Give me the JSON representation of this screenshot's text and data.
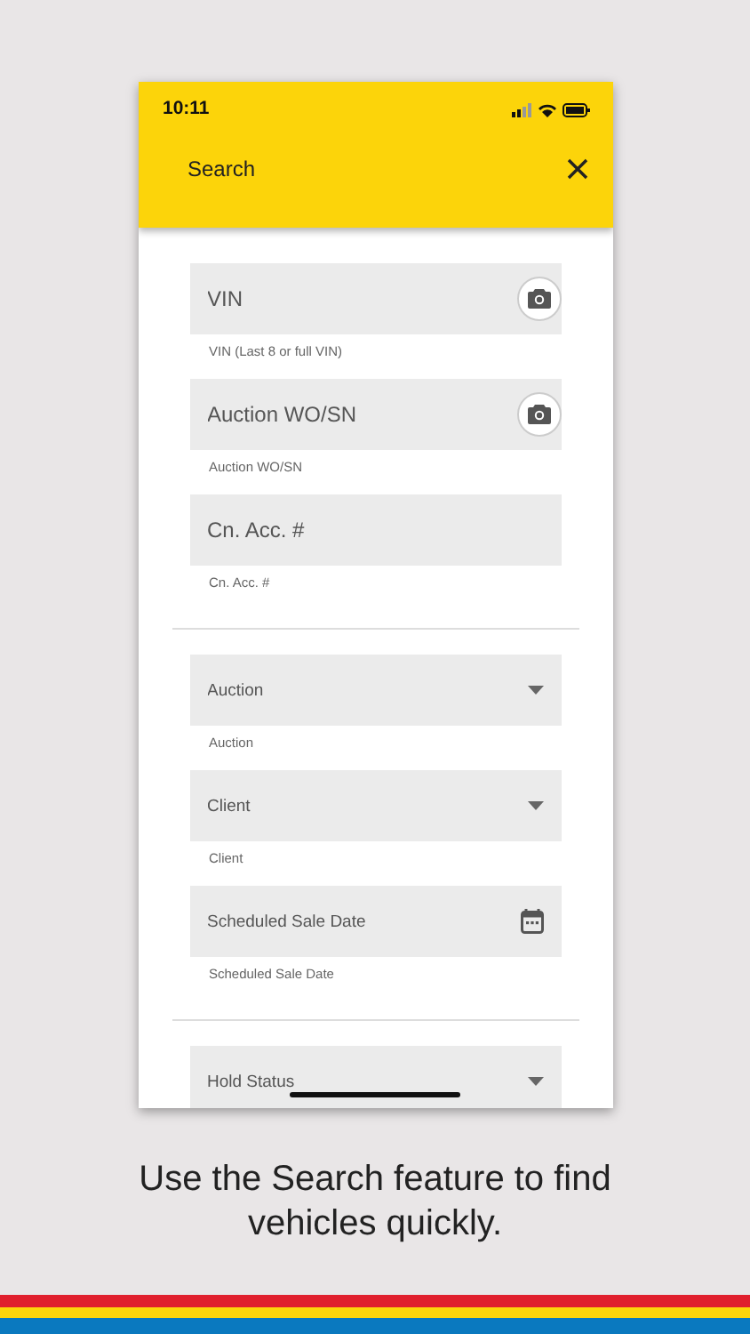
{
  "status_bar": {
    "time": "10:11"
  },
  "header": {
    "title": "Search"
  },
  "sections": [
    {
      "fields": [
        {
          "kind": "camera",
          "placeholder": "VIN",
          "helper": "VIN (Last 8 or full VIN)"
        },
        {
          "kind": "camera",
          "placeholder": "Auction WO/SN",
          "helper": "Auction WO/SN"
        },
        {
          "kind": "text",
          "placeholder": "Cn. Acc. #",
          "helper": "Cn. Acc. #"
        }
      ]
    },
    {
      "fields": [
        {
          "kind": "dropdown",
          "placeholder": "Auction",
          "helper": "Auction"
        },
        {
          "kind": "dropdown",
          "placeholder": "Client",
          "helper": "Client"
        },
        {
          "kind": "date",
          "placeholder": "Scheduled Sale Date",
          "helper": "Scheduled Sale Date"
        }
      ]
    },
    {
      "fields": [
        {
          "kind": "dropdown",
          "placeholder": "Hold Status"
        }
      ]
    }
  ],
  "caption": "Use the Search feature to find vehicles quickly."
}
